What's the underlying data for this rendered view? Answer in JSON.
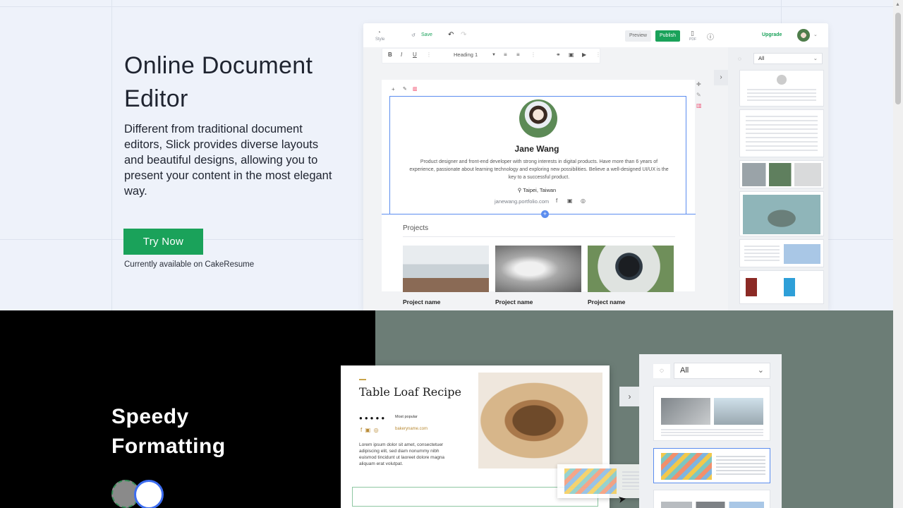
{
  "hero": {
    "title": "Online Document Editor",
    "description": "Different from traditional document editors, Slick provides diverse layouts and beautiful designs, allowing you to present your content in the most elegant way.",
    "cta_label": "Try Now",
    "availability": "Currently available on CakeResume"
  },
  "editor": {
    "topbar": {
      "style_label": "Style",
      "save_label": "Save",
      "preview_label": "Preview",
      "publish_label": "Publish",
      "pdf_label": "PDF",
      "upgrade_label": "Upgrade"
    },
    "format": {
      "heading_select": "Heading 1"
    },
    "profile": {
      "name": "Jane Wang",
      "bio": "Product designer and front-end developer with strong interests in digital products. Have more than 6 years of experience, passionate about learning technology and exploring new possibilities. Believe a well-designed UI/UX is the key to a successful product.",
      "location": "Taipei, Taiwan",
      "portfolio": "janewang.portfolio.com"
    },
    "projects": {
      "title": "Projects",
      "items": [
        {
          "name": "Project name"
        },
        {
          "name": "Project name"
        },
        {
          "name": "Project name"
        }
      ]
    },
    "panel": {
      "filter": "All"
    }
  },
  "speedy": {
    "title": "Speedy Formatting",
    "recipe": {
      "title": "Table Loaf Recipe",
      "popular": "Most popular",
      "url": "bakeryname.com",
      "body": "Lorem ipsum dolor sit amet, consectetuer adipiscing elit, sed diam nonummy nibh euismod tincidunt ut laoreet dolore magna aliquam erat volutpat."
    },
    "panel": {
      "filter": "All"
    }
  },
  "colors": {
    "accent_green": "#1aa25a",
    "selection_blue": "#5b8def",
    "dark_bg": "#000000",
    "sage_bg": "#6c7d76"
  }
}
